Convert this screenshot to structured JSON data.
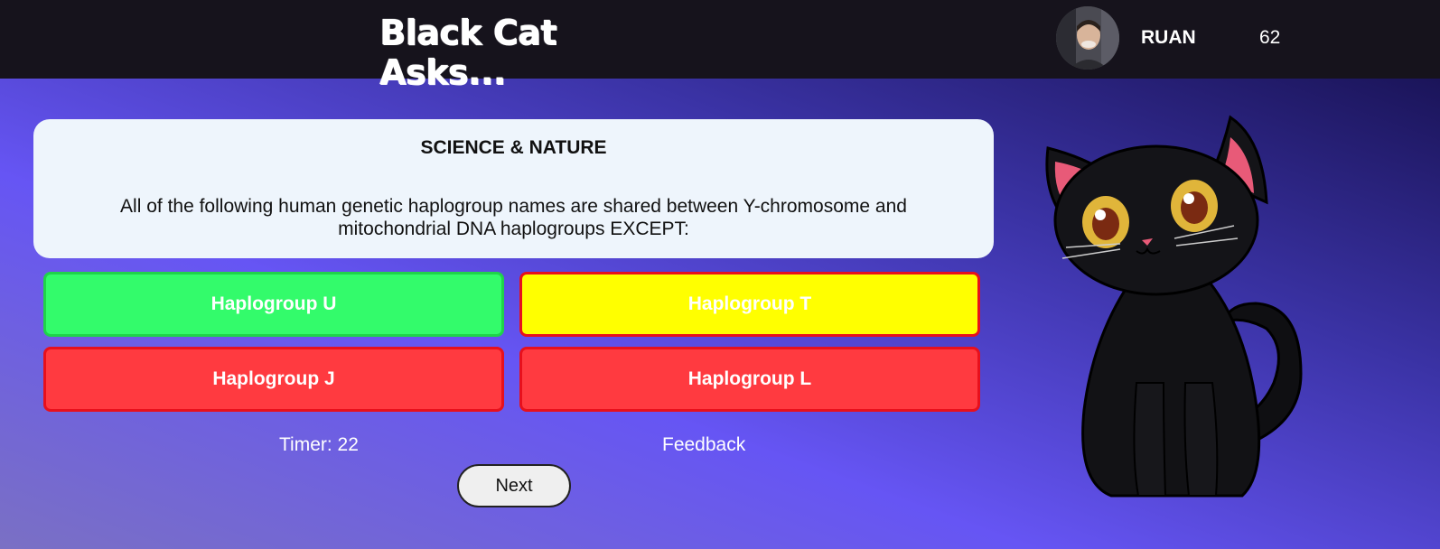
{
  "header": {
    "title": "Black Cat Asks...",
    "username": "RUAN",
    "score": "62"
  },
  "question": {
    "category": "SCIENCE & NATURE",
    "text": "All of the following human genetic haplogroup names are shared between Y-chromosome and mitochondrial DNA haplogroups EXCEPT:"
  },
  "answers": [
    {
      "label": "Haplogroup U",
      "color": "#33fb6b"
    },
    {
      "label": "Haplogroup T",
      "color": "#ffff00"
    },
    {
      "label": "Haplogroup J",
      "color": "#ff3a40"
    },
    {
      "label": "Haplogroup L",
      "color": "#ff3a40"
    }
  ],
  "status": {
    "timer": "Timer: 22",
    "feedback": "Feedback"
  },
  "controls": {
    "next_label": "Next"
  },
  "colors": {
    "topbar": "#16131c",
    "card": "#eef5fc",
    "answer_border": "#e8101c"
  }
}
